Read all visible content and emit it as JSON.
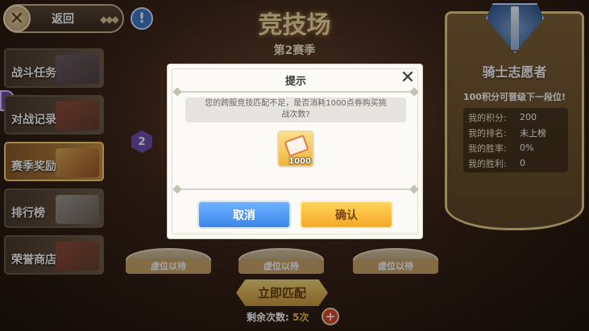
{
  "header": {
    "back_label": "返回",
    "info_icon": "exclamation-icon",
    "title": "竞技场",
    "season": "第2赛季"
  },
  "menu": {
    "items": [
      {
        "label": "战斗任务",
        "active": false
      },
      {
        "label": "对战记录",
        "active": false
      },
      {
        "label": "赛季奖励",
        "active": true
      },
      {
        "label": "排行榜",
        "active": false
      },
      {
        "label": "荣誉商店",
        "active": false
      }
    ]
  },
  "hex_badge": "2",
  "rank_card": {
    "rank_name": "骑士志愿者",
    "hint": "100积分可晋级下一段位!",
    "stats": [
      {
        "label": "我的积分:",
        "value": "200"
      },
      {
        "label": "我的排名:",
        "value": "未上榜"
      },
      {
        "label": "我的胜率:",
        "value": "0%"
      },
      {
        "label": "我的胜利:",
        "value": "0"
      }
    ]
  },
  "slots": [
    "虚位以待",
    "虚位以待",
    "虚位以待"
  ],
  "match_button": "立即匹配",
  "remaining": {
    "label": "剩余次数:",
    "value": "5次"
  },
  "dialog": {
    "title": "提示",
    "message_line1": "您的跨服竞技匹配不足，是否消耗1000点券购买挑",
    "message_line2": "战次数?",
    "item_quantity": "1000",
    "cancel": "取消",
    "confirm": "确认"
  },
  "colors": {
    "cancel_button": "#3a86e8",
    "confirm_button": "#f5a826",
    "gold_accent": "#e7cf8a"
  }
}
